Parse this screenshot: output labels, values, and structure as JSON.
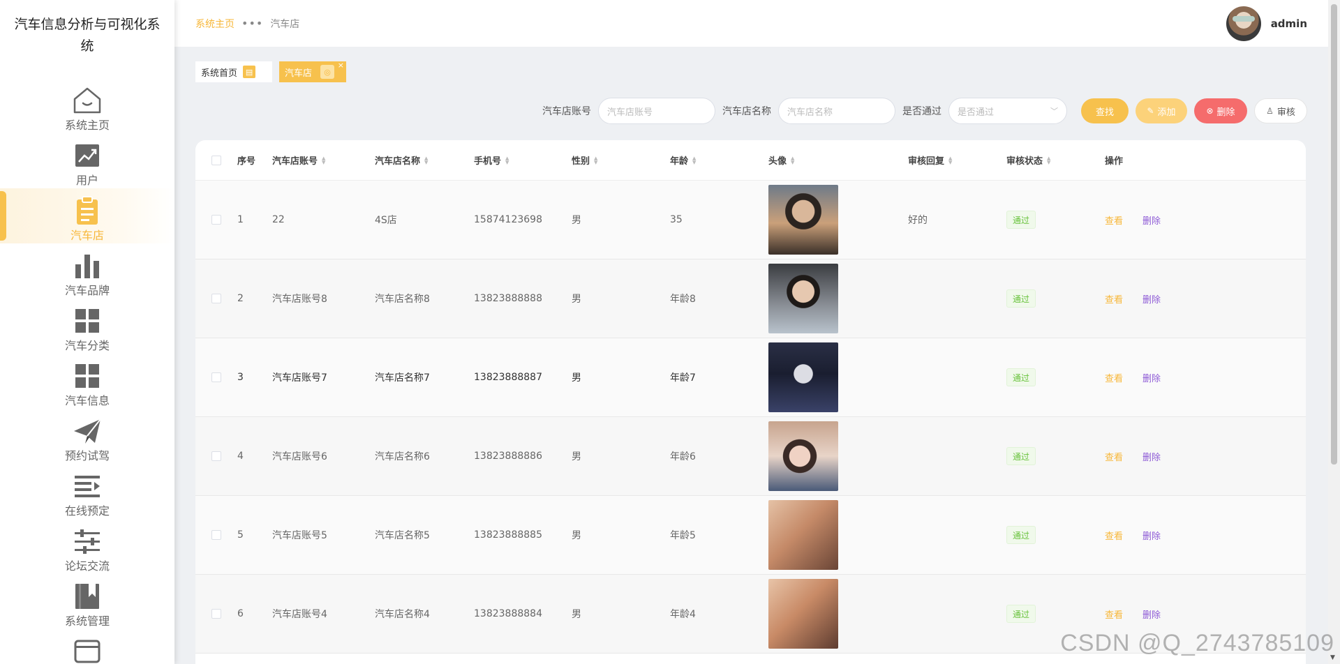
{
  "app": {
    "title": "汽车信息分析与可视化系统"
  },
  "menu": [
    {
      "label": "系统主页",
      "icon": "home-icon"
    },
    {
      "label": "用户",
      "icon": "trend-chart-icon"
    },
    {
      "label": "汽车店",
      "icon": "clipboard-icon",
      "active": true
    },
    {
      "label": "汽车品牌",
      "icon": "bar-chart-icon"
    },
    {
      "label": "汽车分类",
      "icon": "grid-icon"
    },
    {
      "label": "汽车信息",
      "icon": "grid-icon"
    },
    {
      "label": "预约试驾",
      "icon": "paper-plane-icon"
    },
    {
      "label": "在线预定",
      "icon": "list-indent-icon"
    },
    {
      "label": "论坛交流",
      "icon": "sliders-icon"
    },
    {
      "label": "系统管理",
      "icon": "book-icon"
    }
  ],
  "breadcrumb": {
    "home": "系统主页",
    "separator": "•••",
    "current": "汽车店"
  },
  "user": {
    "name": "admin"
  },
  "tabs": [
    {
      "label": "系统首页"
    },
    {
      "label": "汽车店",
      "close": "×"
    }
  ],
  "search": {
    "account_label": "汽车店账号",
    "account_placeholder": "汽车店账号",
    "name_label": "汽车店名称",
    "name_placeholder": "汽车店名称",
    "pass_label": "是否通过",
    "pass_placeholder": "是否通过",
    "find": "查找",
    "add": "添加",
    "delete": "删除",
    "audit": "审核"
  },
  "table": {
    "headers": [
      "序号",
      "汽车店账号",
      "汽车店名称",
      "手机号",
      "性别",
      "年龄",
      "头像",
      "审核回复",
      "审核状态",
      "操作"
    ],
    "rows": [
      {
        "idx": "1",
        "account": "22",
        "name": "4S店",
        "phone": "15874123698",
        "sex": "男",
        "age": "35",
        "reply": "好的",
        "state": "通过"
      },
      {
        "idx": "2",
        "account": "汽车店账号8",
        "name": "汽车店名称8",
        "phone": "13823888888",
        "sex": "男",
        "age": "年龄8",
        "reply": "",
        "state": "通过"
      },
      {
        "idx": "3",
        "account": "汽车店账号7",
        "name": "汽车店名称7",
        "phone": "13823888887",
        "sex": "男",
        "age": "年龄7",
        "reply": "",
        "state": "通过"
      },
      {
        "idx": "4",
        "account": "汽车店账号6",
        "name": "汽车店名称6",
        "phone": "13823888886",
        "sex": "男",
        "age": "年龄6",
        "reply": "",
        "state": "通过"
      },
      {
        "idx": "5",
        "account": "汽车店账号5",
        "name": "汽车店名称5",
        "phone": "13823888885",
        "sex": "男",
        "age": "年龄5",
        "reply": "",
        "state": "通过"
      },
      {
        "idx": "6",
        "account": "汽车店账号4",
        "name": "汽车店名称4",
        "phone": "13823888884",
        "sex": "男",
        "age": "年龄4",
        "reply": "",
        "state": "通过"
      }
    ],
    "view": "查看",
    "delete": "删除"
  },
  "watermark": "CSDN @Q_2743785109",
  "colors": {
    "accent": "#f7b739",
    "danger": "#f56c6c",
    "success": "#67c23a",
    "purple": "#8e5bd6"
  }
}
